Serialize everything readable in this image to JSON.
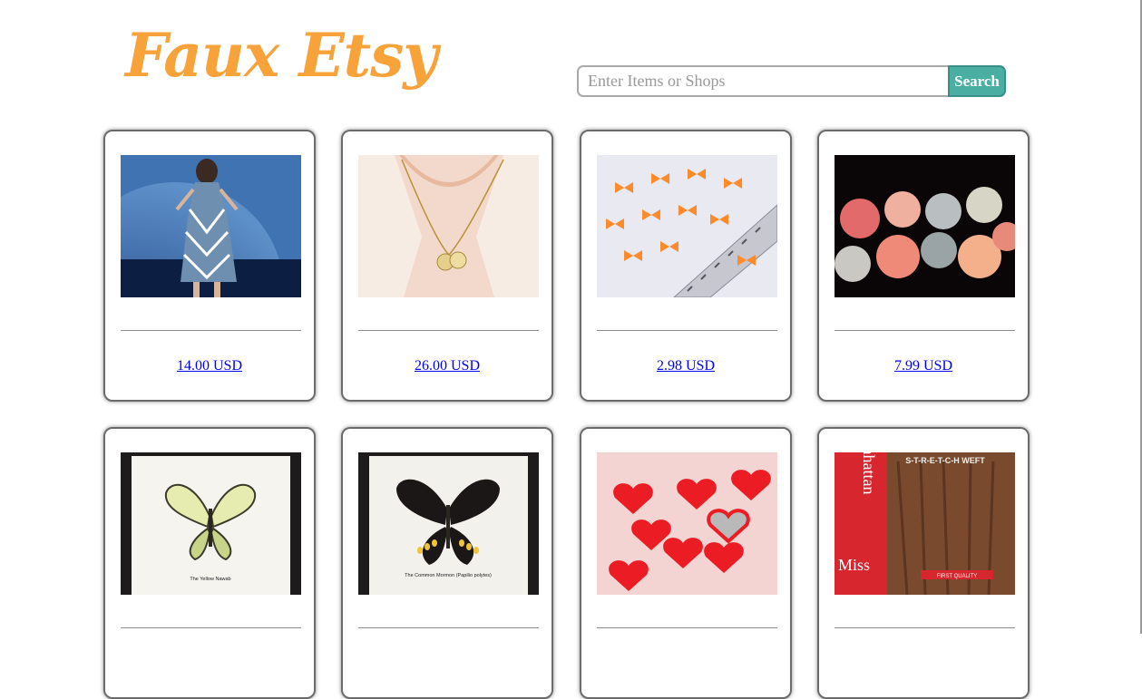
{
  "header": {
    "logo_text": "Faux Etsy",
    "search_placeholder": "Enter Items or Shops",
    "search_value": "",
    "search_button_label": "Search"
  },
  "colors": {
    "logo": "#f8a23a",
    "search_button": "#4aaea3",
    "link": "#0000ee"
  },
  "listings": [
    {
      "image": "dress-icon",
      "price": "14.00 USD"
    },
    {
      "image": "necklace-icon",
      "price": "26.00 USD"
    },
    {
      "image": "ribbon-bows-icon",
      "price": "2.98 USD"
    },
    {
      "image": "lantern-lights-icon",
      "price": "7.99 USD"
    },
    {
      "image": "butterfly-frame-icon",
      "caption": "The Yellow Nawab",
      "price": ""
    },
    {
      "image": "butterfly-frame-icon",
      "caption": "The Common Mormon (Papilio polytes)",
      "price": ""
    },
    {
      "image": "hearts-icon",
      "price": ""
    },
    {
      "image": "hair-package-icon",
      "package_text": [
        "nhattan",
        "Miss",
        "S-T-R-E-T-C-H WEFT",
        "FIRST QUALITY"
      ],
      "price": ""
    }
  ]
}
